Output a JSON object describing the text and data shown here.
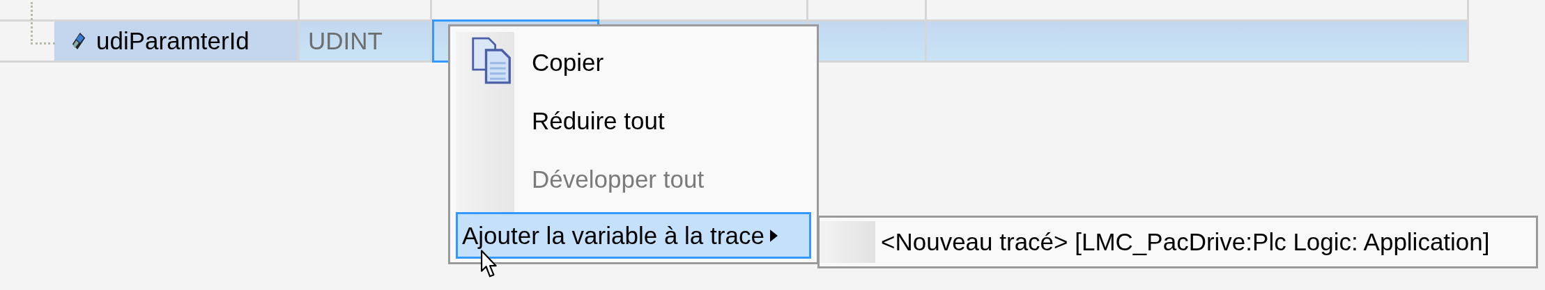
{
  "table": {
    "rows": [
      {
        "name": "udiParamterId",
        "type": "UDINT",
        "selected": true
      }
    ]
  },
  "context_menu": {
    "items": [
      {
        "label": "Copier",
        "kind": "copy",
        "disabled": false,
        "selected": false
      },
      {
        "label": "Réduire tout",
        "kind": "plain",
        "disabled": false,
        "selected": false
      },
      {
        "label": "Développer tout",
        "kind": "plain",
        "disabled": true,
        "selected": false
      },
      {
        "label": "Ajouter la variable à la trace",
        "kind": "submenu",
        "disabled": false,
        "selected": true
      }
    ]
  },
  "submenu": {
    "items": [
      {
        "label": "<Nouveau tracé> [LMC_PacDrive:Plc Logic: Application]",
        "selected": false
      }
    ]
  }
}
